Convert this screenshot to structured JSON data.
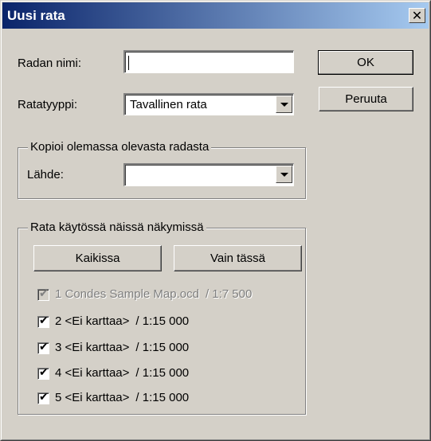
{
  "window": {
    "title": "Uusi rata",
    "close_glyph": "✕"
  },
  "form": {
    "name_label": "Radan nimi:",
    "name_value": "",
    "type_label": "Ratatyyppi:",
    "type_value": "Tavallinen rata"
  },
  "buttons": {
    "ok": "OK",
    "cancel": "Peruuta"
  },
  "copy_group": {
    "legend": "Kopioi olemassa olevasta radasta",
    "source_label": "Lähde:",
    "source_value": ""
  },
  "views_group": {
    "legend": "Rata käytössä näissä näkymissä",
    "all_button": "Kaikissa",
    "only_here_button": "Vain tässä",
    "items": [
      {
        "label": "1 Condes Sample Map.ocd",
        "scale": "/ 1:7 500",
        "checked": true,
        "disabled": true
      },
      {
        "label": "2 <Ei karttaa>",
        "scale": "/ 1:15 000",
        "checked": true,
        "disabled": false
      },
      {
        "label": "3 <Ei karttaa>",
        "scale": "/ 1:15 000",
        "checked": true,
        "disabled": false
      },
      {
        "label": "4 <Ei karttaa>",
        "scale": "/ 1:15 000",
        "checked": true,
        "disabled": false
      },
      {
        "label": "5 <Ei karttaa>",
        "scale": "/ 1:15 000",
        "checked": true,
        "disabled": false
      }
    ]
  },
  "colors": {
    "titlebar_start": "#0a246a",
    "titlebar_end": "#a6caf0",
    "face": "#d4d0c8"
  }
}
